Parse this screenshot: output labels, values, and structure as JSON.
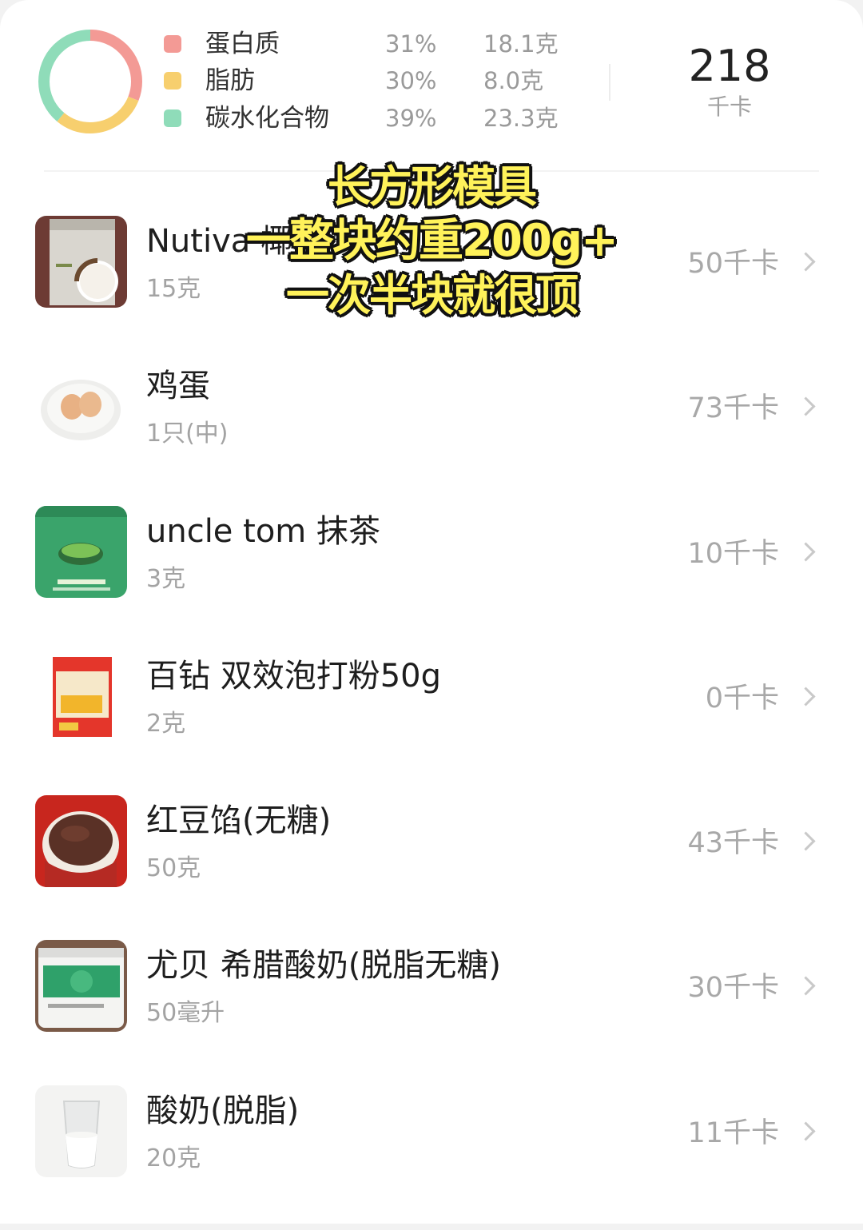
{
  "summary": {
    "macros": [
      {
        "name": "蛋白质",
        "percent": "31%",
        "amount": "18.1克",
        "color": "#f39a95"
      },
      {
        "name": "脂肪",
        "percent": "30%",
        "amount": "8.0克",
        "color": "#f7cf6e"
      },
      {
        "name": "碳水化合物",
        "percent": "39%",
        "amount": "23.3克",
        "color": "#8fdcb9"
      }
    ],
    "total_kcal": "218",
    "total_unit": "千卡"
  },
  "foods": [
    {
      "name": "Nutiva 椰",
      "qty": "15克",
      "kcal": "50千卡",
      "thumb_icon": "coconut-flour-package"
    },
    {
      "name": "鸡蛋",
      "qty": "1只(中)",
      "kcal": "73千卡",
      "thumb_icon": "eggs-on-plate"
    },
    {
      "name": "uncle tom 抹茶",
      "qty": "3克",
      "kcal": "10千卡",
      "thumb_icon": "matcha-package"
    },
    {
      "name": "百钻 双效泡打粉50g",
      "qty": "2克",
      "kcal": "0千卡",
      "thumb_icon": "baking-powder-package"
    },
    {
      "name": "红豆馅(无糖)",
      "qty": "50克",
      "kcal": "43千卡",
      "thumb_icon": "red-bean-paste-bowl"
    },
    {
      "name": "尤贝 希腊酸奶(脱脂无糖)",
      "qty": "50毫升",
      "kcal": "30千卡",
      "thumb_icon": "yogurt-tub"
    },
    {
      "name": "酸奶(脱脂)",
      "qty": "20克",
      "kcal": "11千卡",
      "thumb_icon": "glass-of-milk"
    }
  ],
  "overlay": {
    "line1": "长方形模具",
    "line2": "一整块约重200g+",
    "line3": "一次半块就很顶"
  }
}
